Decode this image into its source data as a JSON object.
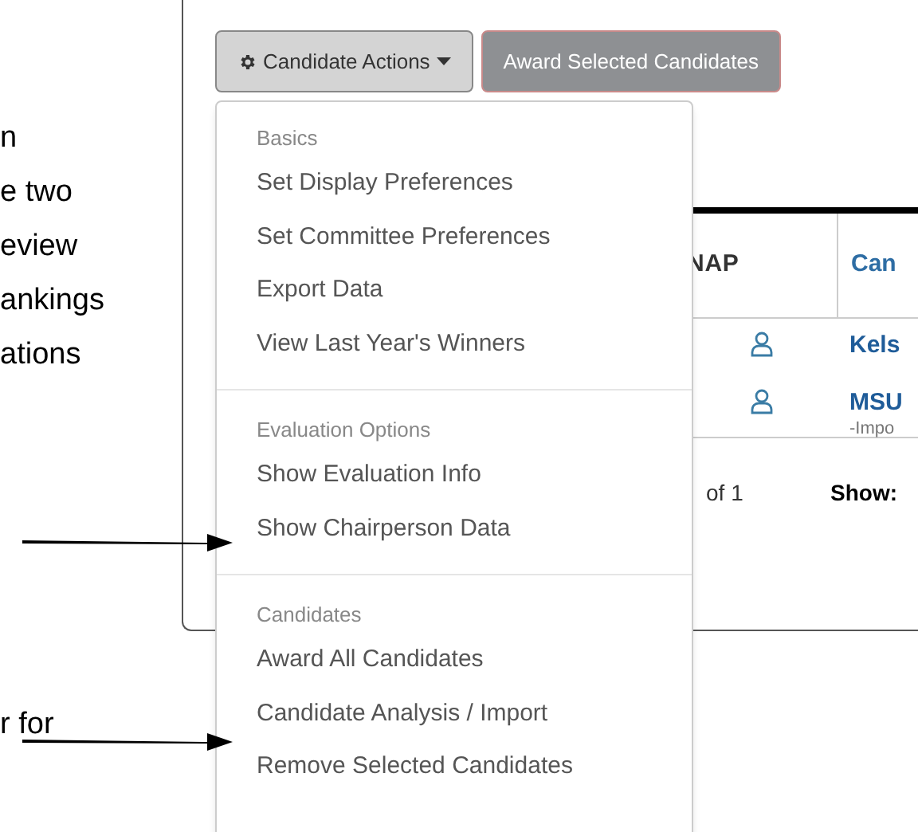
{
  "annotation_lines": [
    "n",
    "e two",
    "eview",
    "ankings",
    "ations"
  ],
  "annotation_bottom": "r for",
  "toolbar": [
    {
      "label": "Candidate Actions",
      "kind": "dropdown"
    },
    {
      "label": "Award Selected Candidates",
      "kind": "primary"
    }
  ],
  "menu": [
    {
      "header": "Basics",
      "items": [
        "Set Display Preferences",
        "Set Committee Preferences",
        "Export Data",
        "View Last Year's Winners"
      ]
    },
    {
      "header": "Evaluation Options",
      "items": [
        "Show Evaluation Info",
        "Show Chairperson Data"
      ]
    },
    {
      "header": "Candidates",
      "items": [
        "Award All Candidates",
        "Candidate Analysis / Import",
        "Remove Selected Candidates"
      ]
    }
  ],
  "table": {
    "columns": [
      "NAP",
      "Can"
    ],
    "rows": [
      {
        "name": "Kels"
      },
      {
        "name": "MSU",
        "note": "-Impo"
      }
    ]
  },
  "pager": {
    "range": "of 1",
    "show_label": "Show:"
  }
}
